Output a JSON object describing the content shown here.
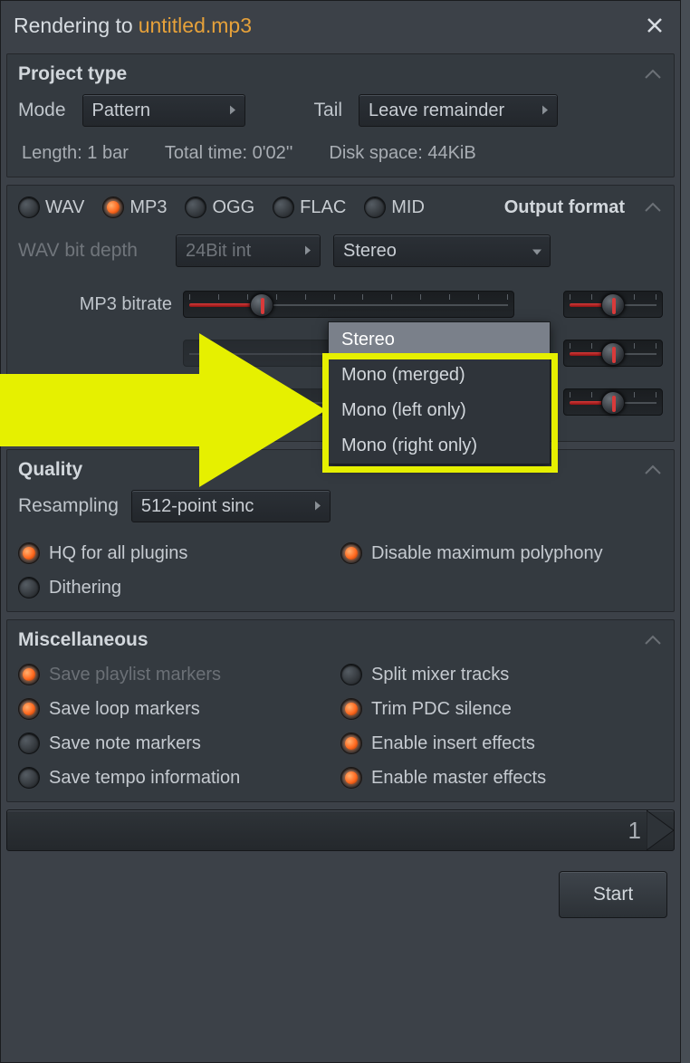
{
  "titlebar": {
    "prefix": "Rendering to",
    "filename": "untitled.mp3"
  },
  "project_type": {
    "title": "Project type",
    "mode_label": "Mode",
    "mode_value": "Pattern",
    "tail_label": "Tail",
    "tail_value": "Leave remainder",
    "length": "Length: 1 bar",
    "total_time": "Total time: 0'02''",
    "disk_space": "Disk space: 44KiB"
  },
  "output": {
    "title": "Output format",
    "formats": [
      {
        "label": "WAV",
        "on": false
      },
      {
        "label": "MP3",
        "on": true
      },
      {
        "label": "OGG",
        "on": false
      },
      {
        "label": "FLAC",
        "on": false
      },
      {
        "label": "MID",
        "on": false
      }
    ],
    "wav_depth_label": "WAV bit depth",
    "wav_depth_value": "24Bit int",
    "channels_value": "Stereo",
    "channels_options": [
      "Stereo",
      "Mono (merged)",
      "Mono (left only)",
      "Mono (right only)"
    ],
    "mp3_bitrate_label": "MP3 bitrate"
  },
  "quality": {
    "title": "Quality",
    "resampling_label": "Resampling",
    "resampling_value": "512-point sinc",
    "hq_label": "HQ for all plugins",
    "disable_poly_label": "Disable maximum polyphony",
    "dithering_label": "Dithering"
  },
  "misc": {
    "title": "Miscellaneous",
    "items": [
      {
        "label": "Save playlist markers",
        "on": true,
        "dim": true
      },
      {
        "label": "Split mixer tracks",
        "on": false
      },
      {
        "label": "Save loop markers",
        "on": true
      },
      {
        "label": "Trim PDC silence",
        "on": true
      },
      {
        "label": "Save note markers",
        "on": false
      },
      {
        "label": "Enable insert effects",
        "on": true
      },
      {
        "label": "Save tempo information",
        "on": false
      },
      {
        "label": "Enable master effects",
        "on": true
      }
    ]
  },
  "progress_value": "1",
  "start_label": "Start"
}
